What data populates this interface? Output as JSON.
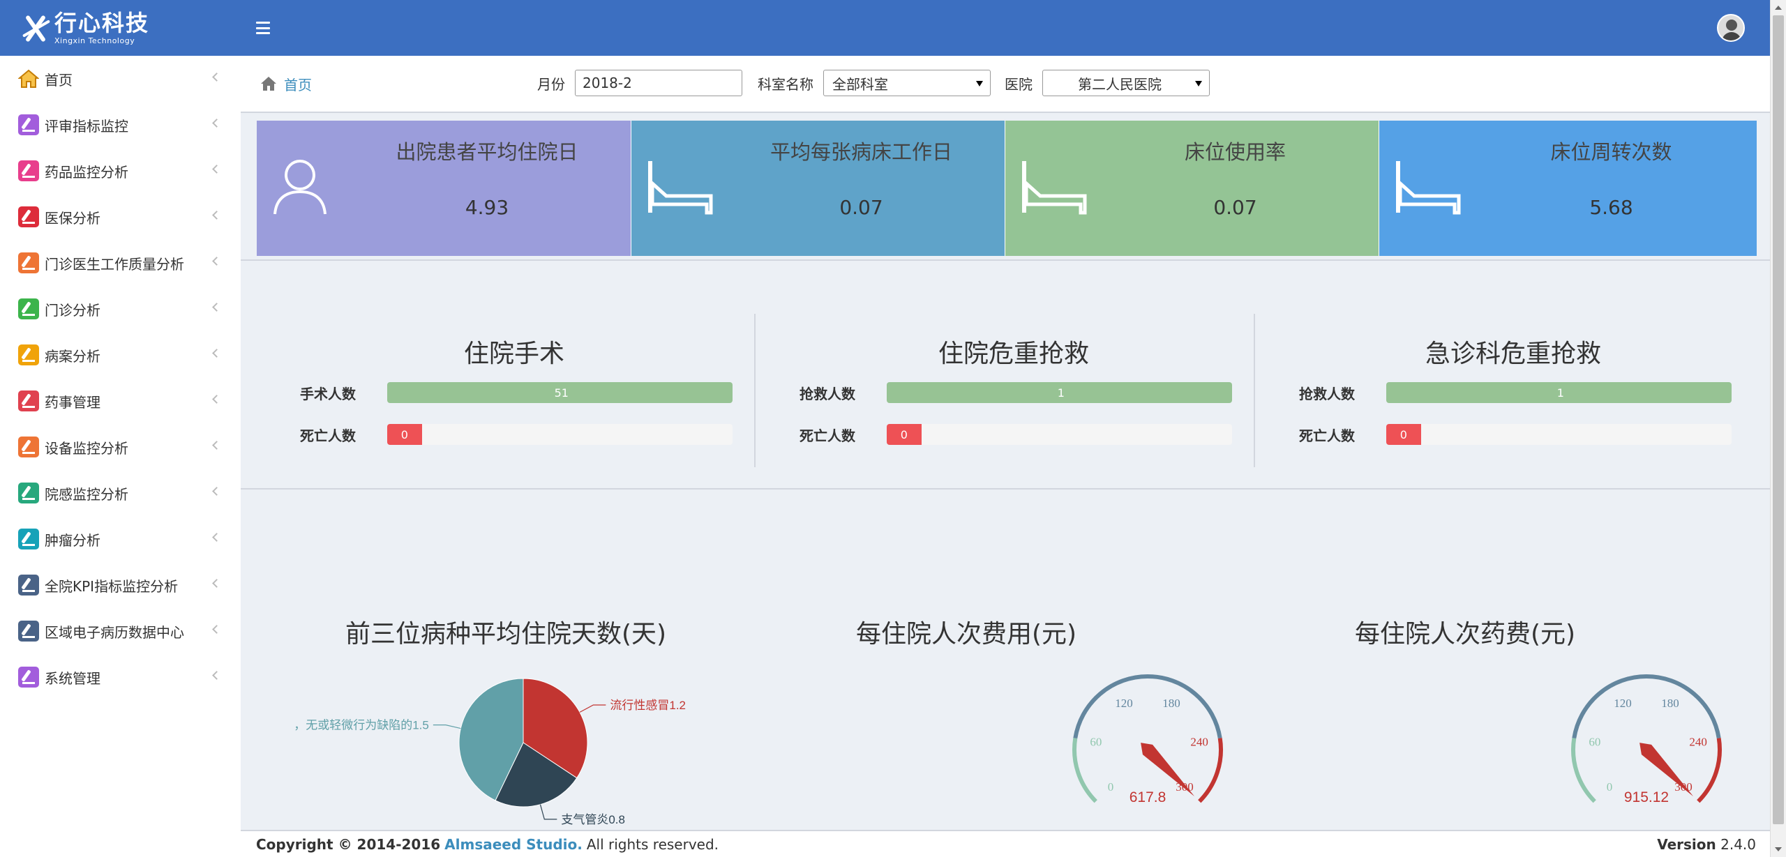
{
  "brand": {
    "cn": "行心科技",
    "en": "Xingxin Technology"
  },
  "sidebar": {
    "items": [
      {
        "label": "首页",
        "color": "#f39c12"
      },
      {
        "label": "评审指标监控",
        "color": "#a25ddc"
      },
      {
        "label": "药品监控分析",
        "color": "#e83e8c"
      },
      {
        "label": "医保分析",
        "color": "#dd2c3a"
      },
      {
        "label": "门诊医生工作质量分析",
        "color": "#ee7435"
      },
      {
        "label": "门诊分析",
        "color": "#3cb44b"
      },
      {
        "label": "病案分析",
        "color": "#f0a30a"
      },
      {
        "label": "药事管理",
        "color": "#e0414f"
      },
      {
        "label": "设备监控分析",
        "color": "#ee7435"
      },
      {
        "label": "院感监控分析",
        "color": "#27a87d"
      },
      {
        "label": "肿瘤分析",
        "color": "#17a2b8"
      },
      {
        "label": "全院KPI指标监控分析",
        "color": "#4a6387"
      },
      {
        "label": "区域电子病历数据中心",
        "color": "#4a6387"
      },
      {
        "label": "系统管理",
        "color": "#a25ddc"
      }
    ]
  },
  "breadcrumb": {
    "home": "首页"
  },
  "filters": {
    "month_label": "月份",
    "month_value": "2018-2",
    "dept_label": "科室名称",
    "dept_value": "全部科室",
    "hospital_label": "医院",
    "hospital_value": "第二人民医院"
  },
  "stats": [
    {
      "title": "出院患者平均住院日",
      "value": "4.93",
      "color": "#9b9ddb",
      "icon": "user-icon"
    },
    {
      "title": "平均每张病床工作日",
      "value": "0.07",
      "color": "#5fa3c9",
      "icon": "bed-icon"
    },
    {
      "title": "床位使用率",
      "value": "0.07",
      "color": "#94c495",
      "icon": "bed-icon"
    },
    {
      "title": "床位周转次数",
      "value": "5.68",
      "color": "#55a1e6",
      "icon": "bed-icon"
    }
  ],
  "ops": [
    {
      "title": "住院手术",
      "row1_label": "手术人数",
      "row1_value": "51",
      "row1_fraction": 1.0,
      "row2_label": "死亡人数",
      "row2_value": "0",
      "row2_fraction": 0.1
    },
    {
      "title": "住院危重抢救",
      "row1_label": "抢救人数",
      "row1_value": "1",
      "row1_fraction": 1.0,
      "row2_label": "死亡人数",
      "row2_value": "0",
      "row2_fraction": 0.1
    },
    {
      "title": "急诊科危重抢救",
      "row1_label": "抢救人数",
      "row1_value": "1",
      "row1_fraction": 1.0,
      "row2_label": "死亡人数",
      "row2_value": "0",
      "row2_fraction": 0.1
    }
  ],
  "colors": {
    "green_bar": "#97c394",
    "red_bar": "#ee5155",
    "pie_red": "#c23531",
    "pie_dark": "#2f4554",
    "pie_teal": "#61a0a8",
    "gauge_blue": "#63869e",
    "gauge_green": "#91c7ae"
  },
  "chart_data": [
    {
      "type": "pie",
      "title": "前三位病种平均住院天数(天)",
      "slices": [
        {
          "label": "流行性感冒1.2",
          "value": 1.2
        },
        {
          "label": "支气管炎0.8",
          "value": 0.8
        },
        {
          "label": "，无或轻微行为缺陷的1.5",
          "value": 1.5
        }
      ]
    },
    {
      "type": "gauge",
      "title": "每住院人次费用(元)",
      "value": 617.8,
      "value_label": "617.8",
      "min": 0,
      "max": 300,
      "ticks": [
        "0",
        "60",
        "120",
        "180",
        "240",
        "300"
      ]
    },
    {
      "type": "gauge",
      "title": "每住院人次药费(元)",
      "value": 915.12,
      "value_label": "915.12",
      "min": 0,
      "max": 300,
      "ticks": [
        "0",
        "60",
        "120",
        "180",
        "240",
        "300"
      ]
    }
  ],
  "footer": {
    "copyright": "Copyright © 2014-2016",
    "studio": "Almsaeed Studio.",
    "rights": "All rights reserved.",
    "version_label": "Version",
    "version": "2.4.0"
  }
}
